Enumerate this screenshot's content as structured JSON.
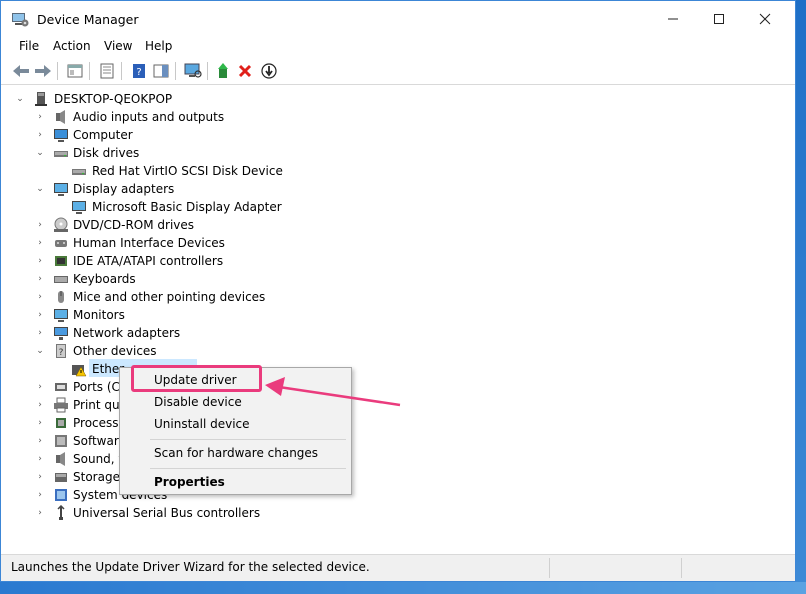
{
  "window": {
    "title": "Device Manager"
  },
  "menu": [
    "File",
    "Action",
    "View",
    "Help"
  ],
  "tree": {
    "root": "DESKTOP-QEOKPOP",
    "items": [
      {
        "label": "Audio inputs and outputs"
      },
      {
        "label": "Computer"
      },
      {
        "label": "Disk drives"
      },
      {
        "label": "Red Hat VirtIO SCSI Disk Device"
      },
      {
        "label": "Display adapters"
      },
      {
        "label": "Microsoft Basic Display Adapter"
      },
      {
        "label": "DVD/CD-ROM drives"
      },
      {
        "label": "Human Interface Devices"
      },
      {
        "label": "IDE ATA/ATAPI controllers"
      },
      {
        "label": "Keyboards"
      },
      {
        "label": "Mice and other pointing devices"
      },
      {
        "label": "Monitors"
      },
      {
        "label": "Network adapters"
      },
      {
        "label": "Other devices"
      },
      {
        "label": "Ether"
      },
      {
        "label": "Ports (CO"
      },
      {
        "label": "Print que"
      },
      {
        "label": "Processo"
      },
      {
        "label": "Software"
      },
      {
        "label": "Sound, v"
      },
      {
        "label": "Storage c"
      },
      {
        "label": "System devices"
      },
      {
        "label": "Universal Serial Bus controllers"
      }
    ]
  },
  "context_menu": {
    "update": "Update driver",
    "disable": "Disable device",
    "uninstall": "Uninstall device",
    "scan": "Scan for hardware changes",
    "properties": "Properties"
  },
  "status": "Launches the Update Driver Wizard for the selected device.",
  "colors": {
    "annotation": "#ea3b7d",
    "selection": "#cce8ff",
    "titlebar_border": "#3c86d6"
  }
}
